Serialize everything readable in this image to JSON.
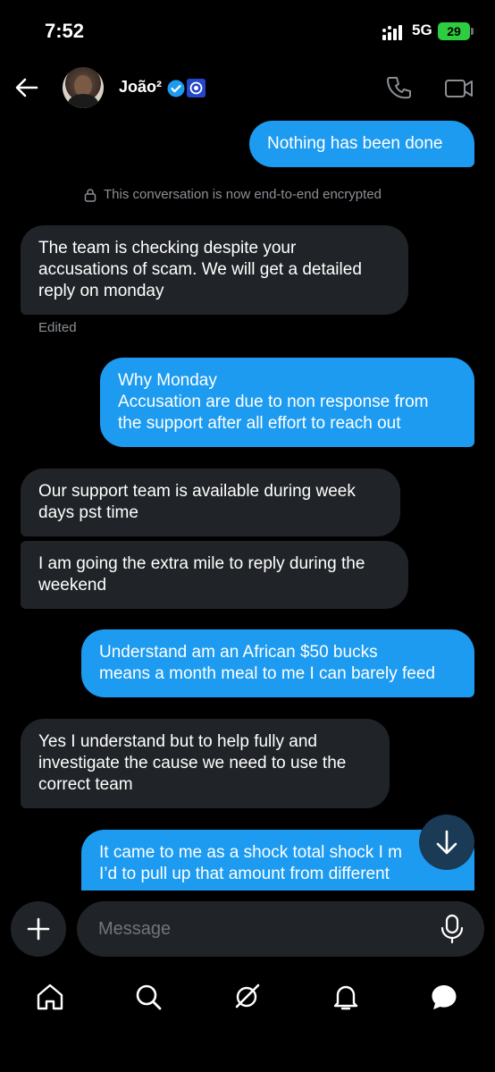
{
  "status_bar": {
    "time": "7:52",
    "network": "5G",
    "battery": "29"
  },
  "header": {
    "contact_name": "João²",
    "avatar_icon": "user-avatar",
    "verified_icon": "verified-badge-icon",
    "affiliation_icon": "affiliate-badge-icon"
  },
  "conversation": {
    "encrypted_notice": "This conversation is now end-to-end encrypted",
    "edited_label": "Edited",
    "messages": [
      {
        "direction": "out",
        "text": "Nothing has been done"
      },
      {
        "direction": "in",
        "text": "The team is checking despite your\naccusations of scam. We will get a detailed\nreply on monday"
      },
      {
        "direction": "out",
        "text": "Why Monday\nAccusation are due to non response from\nthe support after all effort to reach out"
      },
      {
        "direction": "in",
        "text": "Our support team is available during week\ndays pst time"
      },
      {
        "direction": "in",
        "text": "I am going the extra mile to reply during the\nweekend"
      },
      {
        "direction": "out",
        "text": "Understand am an African $50 bucks\nmeans a month meal to me I can barely feed"
      },
      {
        "direction": "in",
        "text": "Yes I understand but to help fully and\ninvestigate the cause we need to use the\ncorrect team"
      },
      {
        "direction": "out",
        "text": "It came to me as a shock total shock I m\nI’d to pull up that amount from different"
      }
    ]
  },
  "composer": {
    "placeholder": "Message"
  },
  "nav": {
    "items": [
      "home-icon",
      "search-icon",
      "grok-icon",
      "notifications-icon",
      "messages-icon"
    ]
  },
  "colors": {
    "accent": "#1d9bf0",
    "incoming_bubble": "#202327",
    "background": "#000000",
    "battery": "#2ecc40"
  }
}
